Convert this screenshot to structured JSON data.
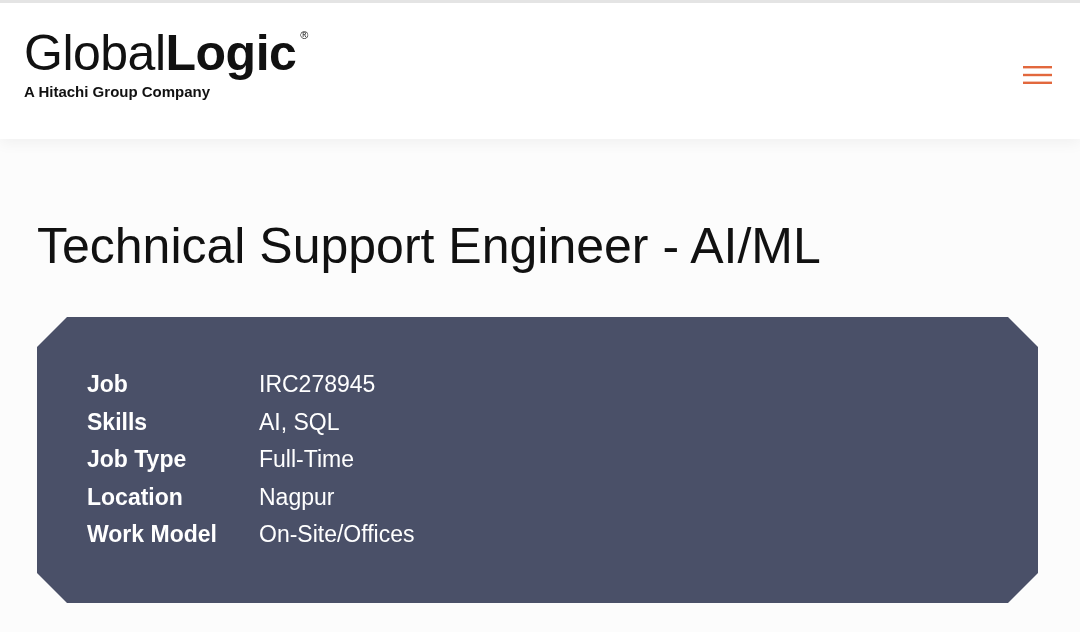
{
  "header": {
    "logo": {
      "wordmark": "Global**Logic**$^{®}$",
      "tagline": "A Hitachi Group Company"
    }
  },
  "job": {
    "title": "Technical Support Engineer - AI/ML",
    "details": [
      {
        "label": "Job",
        "value": "IRC278945"
      },
      {
        "label": "Skills",
        "value": "AI, SQL"
      },
      {
        "label": "Job Type",
        "value": "Full-Time"
      },
      {
        "label": "Location",
        "value": "Nagpur"
      },
      {
        "label": "Work Model",
        "value": "On-Site/Offices"
      }
    ]
  }
}
